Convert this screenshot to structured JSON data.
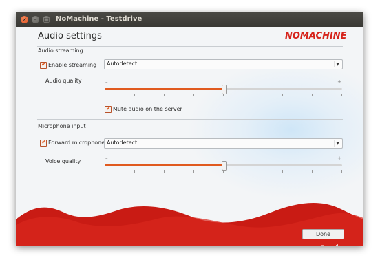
{
  "window": {
    "title": "NoMachine - Testdrive",
    "controls": {
      "close": "×",
      "minimize": "–",
      "maximize": "□"
    }
  },
  "header": {
    "title": "Audio settings",
    "logo": "NOMACHINE",
    "brand_color": "#d6241c"
  },
  "audio_streaming": {
    "section_label": "Audio streaming",
    "enable_label": "Enable streaming",
    "enable_checked": true,
    "select_value": "Autodetect",
    "quality_label": "Audio quality",
    "quality_level": 0.5,
    "mute_label": "Mute audio on the server",
    "mute_checked": true
  },
  "microphone": {
    "section_label": "Microphone input",
    "forward_label": "Forward microphone",
    "forward_checked": true,
    "select_value": "Autodetect",
    "quality_label": "Voice quality",
    "quality_level": 0.5
  },
  "slider_marks": {
    "minus": "–",
    "plus": "+"
  },
  "footer": {
    "done_label": "Done",
    "toolbar_icons": [
      "display-icon",
      "fit-screen-icon",
      "window-icon",
      "scale-icon",
      "resize-icon",
      "fullscreen-icon",
      "display-settings-icon"
    ],
    "accent_color": "#e05a1f"
  }
}
